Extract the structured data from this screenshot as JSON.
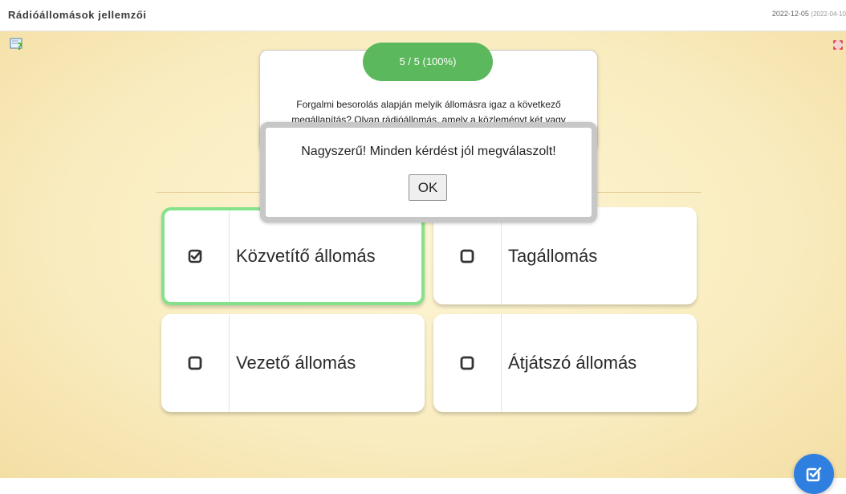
{
  "header": {
    "title": "Rádióállomások jellemzői",
    "date": "2022-12-05",
    "date_secondary": "(2022-04-10"
  },
  "icons": {
    "help": "help-question-icon",
    "fullscreen": "fullscreen-icon",
    "submit": "check-square-icon"
  },
  "quiz": {
    "progress": "5 / 5 (100%)",
    "progress_fraction": 1.0,
    "question": "Forgalmi besorolás alapján melyik állomásra igaz a következő megállapítás? Olyan rádióállomás, amely a közleményt két vagy",
    "options": [
      {
        "label": "Közvetítő állomás",
        "selected": true
      },
      {
        "label": "Tagállomás",
        "selected": false
      },
      {
        "label": "Vezető állomás",
        "selected": false
      },
      {
        "label": "Átjátszó állomás",
        "selected": false
      }
    ]
  },
  "dialog": {
    "message": "Nagyszerű! Minden kérdést jól megválaszolt!",
    "ok_label": "OK"
  },
  "colors": {
    "progress": "#5cb85c",
    "selected_border": "#86e28a",
    "submit_button": "#2f7fe0",
    "background": "#f9ecbf"
  }
}
